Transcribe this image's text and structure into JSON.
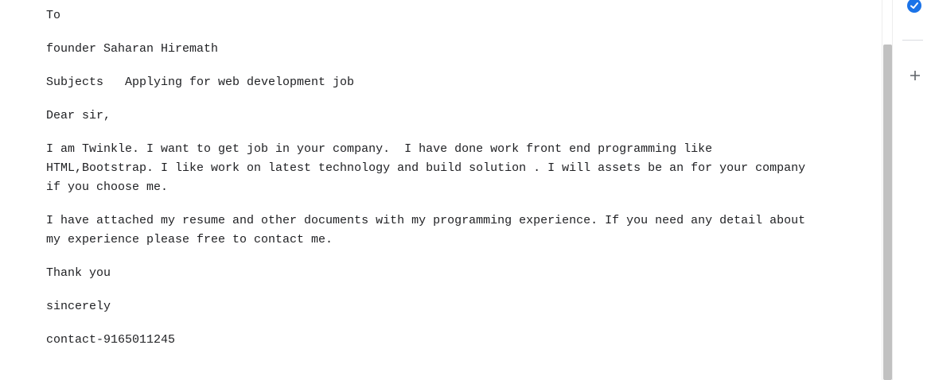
{
  "letter": {
    "to": "To",
    "recipient": "founder Saharan Hiremath",
    "subject": "Subjects   Applying for web development job",
    "greeting": "Dear sir,",
    "para1": [
      "I am Twinkle. I want to get job in your company.  I have done work front end programming like",
      "HTML,Bootstrap. I like work on latest technology and build solution . I will assets be an for your company",
      "if you choose me."
    ],
    "para2": [
      "I have attached my resume and other documents with my programming experience. If you need any detail about",
      "my experience please free to contact me."
    ],
    "thanks": "Thank you",
    "closing": "sincerely",
    "contact": "contact-9165011245"
  },
  "side_panel": {
    "icons": [
      "tasks-icon",
      "add-icon"
    ],
    "accent_color": "#1a73e8"
  }
}
